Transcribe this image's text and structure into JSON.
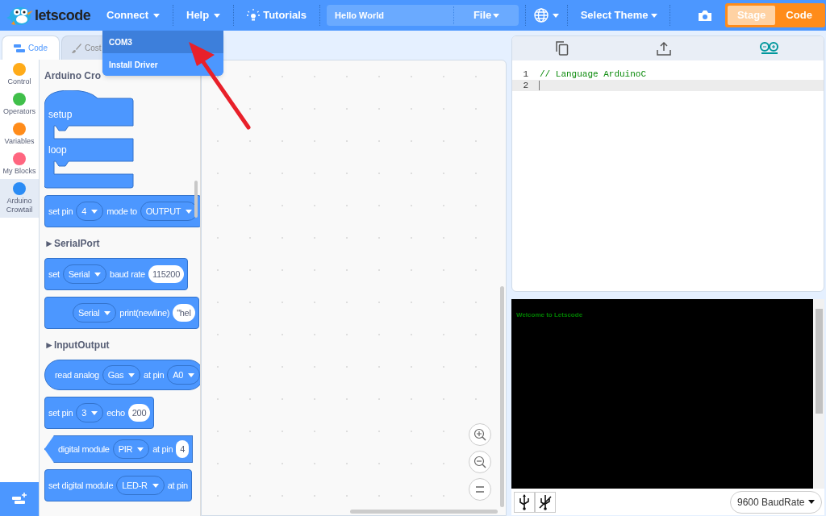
{
  "topbar": {
    "logo": "letscode",
    "nav": [
      {
        "kind": "menu",
        "label": "Connect",
        "open": true
      },
      {
        "kind": "menu",
        "label": "Help",
        "open": false
      },
      {
        "kind": "link",
        "label": "Tutorials"
      }
    ],
    "project": {
      "value": "Hello World",
      "menu": "File"
    },
    "theme_menu": "Select Theme",
    "modes": [
      {
        "label": "Stage",
        "selected": false
      },
      {
        "label": "Code",
        "selected": true
      }
    ]
  },
  "connect_menu": [
    {
      "label": "COM3",
      "selected": true
    },
    {
      "label": "Install Driver",
      "selected": false
    }
  ],
  "tabs": [
    {
      "label": "Code",
      "selected": true
    },
    {
      "label": "Cost",
      "selected": false
    }
  ],
  "categories": [
    {
      "label": "Control",
      "color": "#ffab19",
      "selected": false
    },
    {
      "label": "Operators",
      "color": "#40bf4a",
      "selected": false
    },
    {
      "label": "Variables",
      "color": "#ff8c1a",
      "selected": false
    },
    {
      "label": "My Blocks",
      "color": "#ff6680",
      "selected": false
    },
    {
      "label": "Arduino Crowtail",
      "color": "#2b8cf5",
      "selected": true
    }
  ],
  "palette": [
    {
      "kind": "heading",
      "text": "Arduino Cro"
    },
    {
      "kind": "c_block",
      "labels": [
        "setup",
        "loop"
      ]
    },
    {
      "kind": "stack",
      "parts": [
        {
          "kind": "text",
          "text": "set pin"
        },
        {
          "kind": "dropdown",
          "text": "4"
        },
        {
          "kind": "text",
          "text": "mode to"
        },
        {
          "kind": "dropdown",
          "text": "OUTPUT"
        }
      ]
    },
    {
      "kind": "heading",
      "text": "►SerialPort"
    },
    {
      "kind": "stack",
      "parts": [
        {
          "kind": "text",
          "text": "set"
        },
        {
          "kind": "dropdown",
          "text": "Serial"
        },
        {
          "kind": "text",
          "text": "baud rate"
        },
        {
          "kind": "input",
          "text": "115200"
        }
      ]
    },
    {
      "kind": "stack",
      "indent": true,
      "parts": [
        {
          "kind": "dropdown",
          "text": "Serial"
        },
        {
          "kind": "text",
          "text": "print(newline)"
        },
        {
          "kind": "input",
          "text": "\"hel"
        }
      ]
    },
    {
      "kind": "heading",
      "text": "►InputOutput"
    },
    {
      "kind": "reporter",
      "parts": [
        {
          "kind": "text",
          "text": "read analog"
        },
        {
          "kind": "dropdown",
          "text": "Gas"
        },
        {
          "kind": "text",
          "text": "at pin"
        },
        {
          "kind": "dropdown",
          "text": "A0"
        }
      ]
    },
    {
      "kind": "stack",
      "parts": [
        {
          "kind": "text",
          "text": "set pin"
        },
        {
          "kind": "dropdown",
          "text": "3"
        },
        {
          "kind": "text",
          "text": "echo"
        },
        {
          "kind": "input",
          "text": "200"
        }
      ]
    },
    {
      "kind": "boolean",
      "parts": [
        {
          "kind": "text",
          "text": "digital module"
        },
        {
          "kind": "dropdown",
          "text": "PIR"
        },
        {
          "kind": "text",
          "text": "at pin"
        },
        {
          "kind": "input",
          "text": "4"
        }
      ]
    },
    {
      "kind": "stack",
      "parts": [
        {
          "kind": "text",
          "text": "set digital module"
        },
        {
          "kind": "dropdown",
          "text": "LED-R"
        },
        {
          "kind": "text",
          "text": "at pin"
        }
      ]
    }
  ],
  "editor": {
    "lines": [
      {
        "number": "1",
        "text": "// Language ArduinoC",
        "active": false
      },
      {
        "number": "2",
        "active": true
      }
    ]
  },
  "console": {
    "text": "Welcome to Letscode"
  },
  "baud_rate": "9600 BaudRate"
}
